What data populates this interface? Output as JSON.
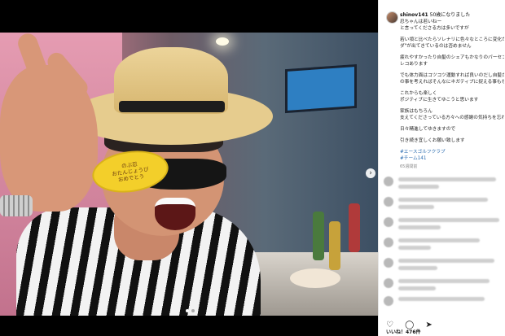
{
  "post": {
    "username": "shinov141",
    "caption_lines": [
      "50歳になりました",
      "忍ちゃんは若いねー",
      "と言ってくださる方は多いですが",
      "",
      "若い頃と比べたらソレナリに色々なところに変化が",
      "ダ\"が出てきているのは否めません",
      "",
      "疲れやすかったり自髪のシェアもかなりのパーセン",
      "レコあります",
      "",
      "でも体力面はコツコツ運動すれば良いのだし自髪だ",
      "の事を考えればそんなにネガティブに捉える事もな",
      "",
      "これからも楽しく",
      "ポジティブに生きてゆこうと思います",
      "",
      "家族はもちろん",
      "支えてくださっている方々への感謝の気持ちを忘れ",
      "",
      "日々精進してゆきますので",
      "",
      "引き続き宜しくお願い致します"
    ],
    "hashtags": [
      "#エースゴルフクラブ",
      "#チーム141"
    ],
    "time_ago": "65週間前",
    "likes": "いいね！476件"
  },
  "photo": {
    "chip_text": [
      "のぶ忍",
      "おたんじょうび",
      "おめでとう"
    ]
  },
  "icons": {
    "like": "heart-icon",
    "comment": "comment-icon",
    "share": "share-icon"
  },
  "colors": {
    "hashtag": "#2b6cb0",
    "chip": "#f3cf2a"
  }
}
